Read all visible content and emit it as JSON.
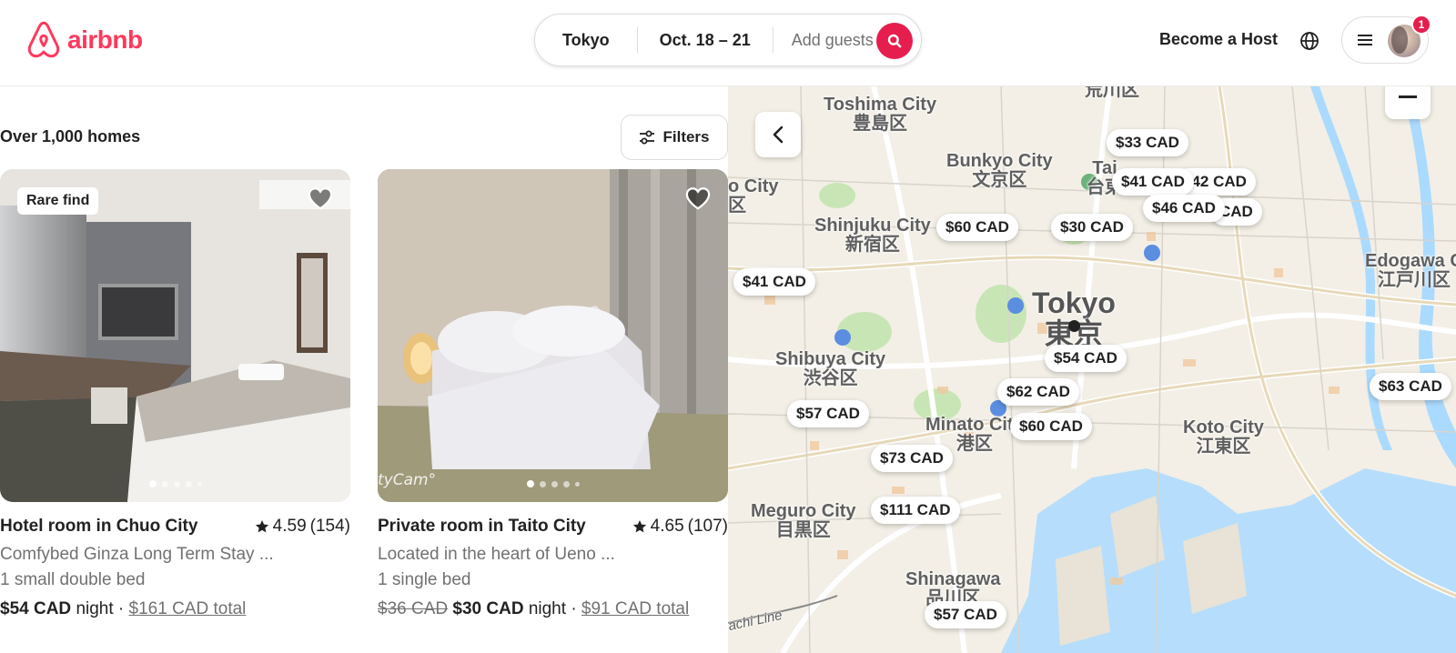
{
  "brand": {
    "name": "airbnb",
    "color": "#FF385C"
  },
  "search": {
    "location": "Tokyo",
    "dates": "Oct. 18 – 21",
    "guests_placeholder": "Add guests",
    "button_icon": "search-icon"
  },
  "header": {
    "host_link": "Become a Host",
    "language_icon": "globe-icon",
    "menu_icon": "hamburger-icon",
    "notification_count": "1"
  },
  "results": {
    "count_label": "Over 1,000 homes",
    "filters_label": "Filters"
  },
  "listings": [
    {
      "badge": "Rare find",
      "title": "Hotel room in Chuo City",
      "rating": "4.59",
      "reviews": "(154)",
      "subtitle": "Comfybed Ginza Long Term Stay ...",
      "beds": "1 small double bed",
      "price": "$54 CAD",
      "unit": "night",
      "separator": "·",
      "total": "$161 CAD total",
      "photo_count": 5,
      "active_photo": 1
    },
    {
      "watermark": "tyCam°",
      "title": "Private room in Taito City",
      "rating": "4.65",
      "reviews": "(107)",
      "subtitle": "Located in the heart of Ueno ...",
      "beds": "1 single bed",
      "original_price": "$36 CAD",
      "price": "$30 CAD",
      "unit": "night",
      "separator": "·",
      "total": "$91 CAD total",
      "photo_count": 5,
      "active_photo": 1
    }
  ],
  "map": {
    "labels": [
      {
        "en": "Toshima City",
        "jp": "豊島区"
      },
      {
        "en": "Bunkyo City",
        "jp": "文京区"
      },
      {
        "en": "Shinjuku City",
        "jp": "新宿区"
      },
      {
        "en": "Shibuya City",
        "jp": "渋谷区"
      },
      {
        "en": "Minato City",
        "jp": "港区"
      },
      {
        "en": "Meguro City",
        "jp": "目黒区"
      },
      {
        "en": "Shinagawa",
        "jp": "品川区"
      },
      {
        "en": "Koto City",
        "jp": "江東区"
      },
      {
        "en": "Edogawa C",
        "jp": "江戸川区"
      },
      {
        "en": "o City",
        "jp": "区"
      },
      {
        "en": "Tai",
        "jp": "台東"
      },
      {
        "en": "",
        "jp": "荒川区"
      },
      {
        "en": "Tokyo",
        "jp": "東京"
      }
    ],
    "rail_label": "achi Line",
    "price_pins": [
      "$33 CAD",
      "$42 CAD",
      "$41 CAD",
      "CAD",
      "$46 CAD",
      "$60 CAD",
      "$30 CAD",
      "$41 CAD",
      "$54 CAD",
      "$62 CAD",
      "$60 CAD",
      "$57 CAD",
      "$73 CAD",
      "$111 CAD",
      "$57 CAD",
      "$63 CAD"
    ]
  }
}
